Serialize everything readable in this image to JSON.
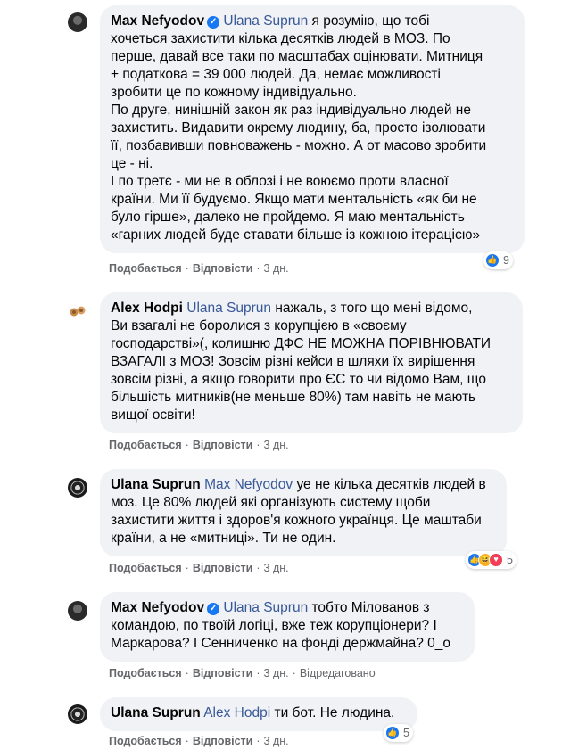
{
  "comments": [
    {
      "author": "Max Nefyodov",
      "verified": true,
      "mention": "Ulana Suprun",
      "lines": [
        " я розумію, що тобі",
        "хочеться захистити кілька десятків людей в МОЗ. По",
        "перше, давай все таки по масштабах оцінювати. Митниця",
        "+ податкова = 39 000 людей. Да, немає можливості",
        "зробити це по кожному індивідуально.",
        "По друге, нинішній закон як раз індивідуально людей не",
        "захистить. Видавити окрему людину, ба, просто ізолювати",
        "її, позбавивши повноважень - можно. А от масово зробити",
        "це - ні.",
        "І по третє - ми не в облозі і не воюємо проти власної",
        "країни. Ми її будуємо. Якщо мати ментальність «як би не",
        "було гірше», далеко не пройдемо. Я маю ментальність",
        "«гарних людей буде ставати більше із кожною ітерацією»"
      ],
      "like_label": "Подобається",
      "reply_label": "Відповісти",
      "time": "3 дн.",
      "reaction_count": "9"
    },
    {
      "author": "Alex Hodpi",
      "mention": "Ulana Suprun",
      "lines": [
        " нажаль, з того що мені відомо,",
        "Ви взагалі не боролися з корупцією в «своєму",
        "господарстві»(, колишню ДФС НЕ МОЖНА ПОРІВНЮВАТИ",
        "ВЗАГАЛІ з МОЗ! Зовсім різні кейси в шляхи їх вирішення",
        "зовсім різні, а якщо говорити про ЄС то чи відомо Вам, що",
        "більшість митників(не меньше 80%) там навіть не мають",
        "вищої освіти!"
      ],
      "like_label": "Подобається",
      "reply_label": "Відповісти",
      "time": "3 дн."
    },
    {
      "author": "Ulana Suprun",
      "mention": "Max Nefyodov",
      "lines": [
        " уе не кілька десятків людей в",
        "моз. Це 80% людей які організують систему щоби",
        "захистити життя і здоров'я кожного українця. Це маштаби",
        "країни, а не «митниці». Ти не один."
      ],
      "like_label": "Подобається",
      "reply_label": "Відповісти",
      "time": "3 дн.",
      "reaction_count": "5"
    },
    {
      "author": "Max Nefyodov",
      "verified": true,
      "mention": "Ulana Suprun",
      "lines": [
        " тобто Мілованов з",
        "командою, по твоїй логіці, вже теж корупціонери? І",
        "Маркарова? І Сенниченко на фонді держмайна? 0_о"
      ],
      "like_label": "Подобається",
      "reply_label": "Відповісти",
      "time": "3 дн.",
      "edited_label": "Відредаговано"
    },
    {
      "author": "Ulana Suprun",
      "mention": "Alex Hodpi",
      "lines": [
        " ти бот. Не людина."
      ],
      "like_label": "Подобається",
      "reply_label": "Відповісти",
      "time": "3 дн.",
      "reaction_count": "5"
    }
  ],
  "colors": {
    "bubble": "#f0f2f5",
    "mention": "#385898",
    "meta": "#65676b",
    "like": "#1877f2",
    "haha": "#f7b125",
    "love": "#f33e58"
  },
  "icons": [
    "verified-icon",
    "like-reaction-icon",
    "haha-reaction-icon",
    "love-reaction-icon"
  ]
}
